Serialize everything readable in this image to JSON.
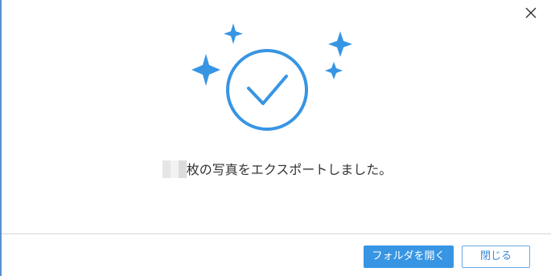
{
  "dialog": {
    "message_suffix": "枚の写真をエクスポートしました。",
    "open_folder_label": "フォルダを開く",
    "close_label": "閉じる",
    "accent_color": "#3795e3"
  },
  "icons": {
    "close": "close-icon",
    "success": "check-circle-icon",
    "sparkle": "sparkle-icon"
  }
}
